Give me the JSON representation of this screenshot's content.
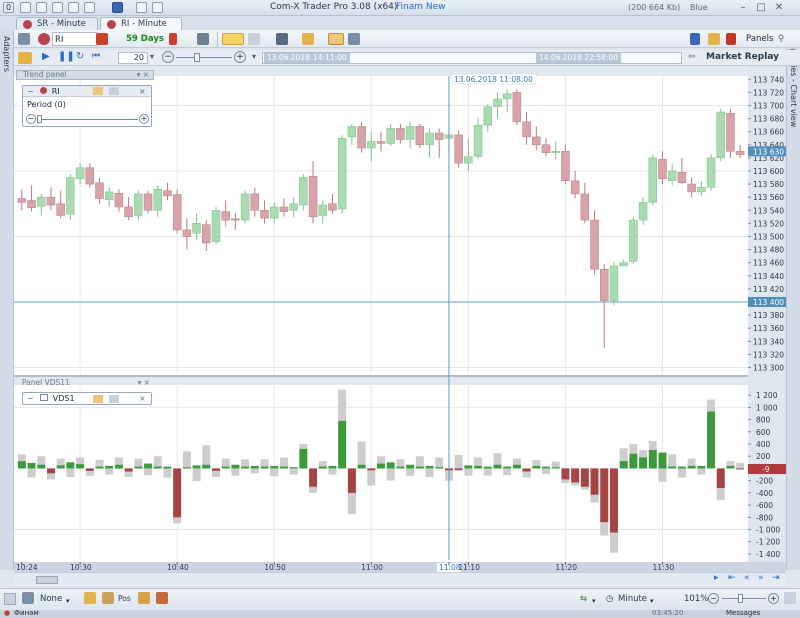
{
  "window": {
    "title": "Com-X Trader Pro 3.08 (x64)",
    "broker": "Finam New",
    "memory": "(200 664 Kb)",
    "theme": "Blue",
    "window_number": "0"
  },
  "tabs": [
    {
      "label": "SR - Minute",
      "active": false
    },
    {
      "label": "RI - Minute",
      "active": true
    }
  ],
  "toolbar": {
    "instrument": "RI",
    "period": "59 Days",
    "panels_label": "Panels"
  },
  "replay": {
    "step": "20",
    "label": "Market Replay",
    "start_date": "13.06.2018",
    "start_time": "14:11:00",
    "end_datetime": "14.06.2018 22:58:00"
  },
  "sidebars": {
    "left_label": "Adapters",
    "right_label": "Properties - Chart view"
  },
  "cursor_label": "13.06.2018 11:08:00",
  "trend_panel": {
    "title": "Trend panel",
    "indicator": "RI",
    "param": "Period (0)"
  },
  "volume_panel": {
    "title": "Panel VDS11",
    "indicator": "VDS1"
  },
  "statusbar": {
    "mode": "None",
    "pos": "Pos",
    "timeframe": "Minute",
    "zoom": "101%",
    "company": "Финам",
    "clock": "03:45:20",
    "messages": "Messages"
  },
  "colors": {
    "up": "#a8dcb0",
    "up_edge": "#7fbf8c",
    "down": "#d8a4aa",
    "down_edge": "#b57c84",
    "vol_pos": "#3c9a3c",
    "vol_neg": "#a64444",
    "vol_gray": "#cdcdcd",
    "axis_bg": "#dfe6ee",
    "price_label_bg": "#4f8fb8",
    "vol_label_bg": "#b23a3a"
  },
  "chart_data": {
    "type": "candlestick",
    "price_axis": [
      "113 740",
      "113 720",
      "113 700",
      "113 680",
      "113 660",
      "113 640",
      "113 620",
      "113 600",
      "113 580",
      "113 560",
      "113 540",
      "113 520",
      "113 500",
      "113 480",
      "113 460",
      "113 440",
      "113 420",
      "113 400",
      "113 380",
      "113 360",
      "113 340",
      "113 320",
      "113 300"
    ],
    "price_ylim": [
      113290,
      113745
    ],
    "current_price": "113 630",
    "cursor_price": "113 400",
    "volume_axis": [
      "1 200",
      "1 000",
      "800",
      "600",
      "400",
      "200",
      "0",
      "-200",
      "-400",
      "-600",
      "-800",
      "-1 000",
      "-1 200",
      "-1 400"
    ],
    "volume_ylim": [
      -1500,
      1350
    ],
    "current_volume": "-9",
    "time_axis": [
      "10:24",
      "10:30",
      "10:40",
      "10:50",
      "11:00",
      "11:08",
      "11:10",
      "11:20",
      "11:30"
    ],
    "time_axis_minutes": [
      624,
      630,
      640,
      650,
      660,
      668,
      670,
      680,
      690
    ],
    "highlighted_time": "11:08",
    "candles": [
      {
        "o": 113558,
        "h": 113572,
        "l": 113540,
        "c": 113552
      },
      {
        "o": 113555,
        "h": 113578,
        "l": 113538,
        "c": 113544
      },
      {
        "o": 113546,
        "h": 113565,
        "l": 113532,
        "c": 113560
      },
      {
        "o": 113560,
        "h": 113575,
        "l": 113540,
        "c": 113548
      },
      {
        "o": 113550,
        "h": 113570,
        "l": 113528,
        "c": 113532
      },
      {
        "o": 113534,
        "h": 113595,
        "l": 113525,
        "c": 113590
      },
      {
        "o": 113588,
        "h": 113612,
        "l": 113580,
        "c": 113605
      },
      {
        "o": 113605,
        "h": 113612,
        "l": 113575,
        "c": 113580
      },
      {
        "o": 113582,
        "h": 113590,
        "l": 113550,
        "c": 113558
      },
      {
        "o": 113556,
        "h": 113575,
        "l": 113545,
        "c": 113568
      },
      {
        "o": 113566,
        "h": 113572,
        "l": 113538,
        "c": 113545
      },
      {
        "o": 113545,
        "h": 113560,
        "l": 113525,
        "c": 113530
      },
      {
        "o": 113532,
        "h": 113570,
        "l": 113525,
        "c": 113565
      },
      {
        "o": 113565,
        "h": 113570,
        "l": 113535,
        "c": 113540
      },
      {
        "o": 113540,
        "h": 113578,
        "l": 113530,
        "c": 113572
      },
      {
        "o": 113570,
        "h": 113582,
        "l": 113555,
        "c": 113562
      },
      {
        "o": 113564,
        "h": 113572,
        "l": 113505,
        "c": 113510
      },
      {
        "o": 113510,
        "h": 113528,
        "l": 113480,
        "c": 113500
      },
      {
        "o": 113505,
        "h": 113535,
        "l": 113495,
        "c": 113520
      },
      {
        "o": 113518,
        "h": 113525,
        "l": 113478,
        "c": 113490
      },
      {
        "o": 113492,
        "h": 113545,
        "l": 113488,
        "c": 113540
      },
      {
        "o": 113538,
        "h": 113555,
        "l": 113515,
        "c": 113525
      },
      {
        "o": 113527,
        "h": 113535,
        "l": 113510,
        "c": 113525
      },
      {
        "o": 113525,
        "h": 113570,
        "l": 113520,
        "c": 113565
      },
      {
        "o": 113565,
        "h": 113575,
        "l": 113530,
        "c": 113540
      },
      {
        "o": 113540,
        "h": 113555,
        "l": 113520,
        "c": 113528
      },
      {
        "o": 113528,
        "h": 113552,
        "l": 113520,
        "c": 113545
      },
      {
        "o": 113545,
        "h": 113558,
        "l": 113530,
        "c": 113538
      },
      {
        "o": 113540,
        "h": 113560,
        "l": 113530,
        "c": 113550
      },
      {
        "o": 113548,
        "h": 113595,
        "l": 113540,
        "c": 113590
      },
      {
        "o": 113592,
        "h": 113615,
        "l": 113520,
        "c": 113530
      },
      {
        "o": 113532,
        "h": 113555,
        "l": 113520,
        "c": 113548
      },
      {
        "o": 113550,
        "h": 113565,
        "l": 113535,
        "c": 113540
      },
      {
        "o": 113542,
        "h": 113655,
        "l": 113535,
        "c": 113650
      },
      {
        "o": 113652,
        "h": 113672,
        "l": 113640,
        "c": 113668
      },
      {
        "o": 113668,
        "h": 113675,
        "l": 113628,
        "c": 113635
      },
      {
        "o": 113635,
        "h": 113660,
        "l": 113615,
        "c": 113645
      },
      {
        "o": 113645,
        "h": 113660,
        "l": 113630,
        "c": 113642
      },
      {
        "o": 113642,
        "h": 113672,
        "l": 113638,
        "c": 113665
      },
      {
        "o": 113665,
        "h": 113672,
        "l": 113642,
        "c": 113648
      },
      {
        "o": 113648,
        "h": 113675,
        "l": 113635,
        "c": 113668
      },
      {
        "o": 113668,
        "h": 113672,
        "l": 113635,
        "c": 113640
      },
      {
        "o": 113640,
        "h": 113665,
        "l": 113620,
        "c": 113658
      },
      {
        "o": 113658,
        "h": 113665,
        "l": 113620,
        "c": 113648
      },
      {
        "o": 113650,
        "h": 113665,
        "l": 113628,
        "c": 113655
      },
      {
        "o": 113655,
        "h": 113662,
        "l": 113605,
        "c": 113612
      },
      {
        "o": 113612,
        "h": 113650,
        "l": 113600,
        "c": 113622
      },
      {
        "o": 113622,
        "h": 113680,
        "l": 113618,
        "c": 113670
      },
      {
        "o": 113670,
        "h": 113702,
        "l": 113660,
        "c": 113698
      },
      {
        "o": 113698,
        "h": 113720,
        "l": 113680,
        "c": 113710
      },
      {
        "o": 113710,
        "h": 113725,
        "l": 113690,
        "c": 113718
      },
      {
        "o": 113720,
        "h": 113725,
        "l": 113670,
        "c": 113675
      },
      {
        "o": 113675,
        "h": 113690,
        "l": 113640,
        "c": 113652
      },
      {
        "o": 113652,
        "h": 113668,
        "l": 113632,
        "c": 113640
      },
      {
        "o": 113640,
        "h": 113650,
        "l": 113622,
        "c": 113628
      },
      {
        "o": 113628,
        "h": 113645,
        "l": 113618,
        "c": 113630
      },
      {
        "o": 113630,
        "h": 113640,
        "l": 113580,
        "c": 113585
      },
      {
        "o": 113585,
        "h": 113600,
        "l": 113558,
        "c": 113565
      },
      {
        "o": 113565,
        "h": 113582,
        "l": 113520,
        "c": 113525
      },
      {
        "o": 113525,
        "h": 113540,
        "l": 113442,
        "c": 113450
      },
      {
        "o": 113450,
        "h": 113458,
        "l": 113330,
        "c": 113402
      },
      {
        "o": 113402,
        "h": 113462,
        "l": 113395,
        "c": 113455
      },
      {
        "o": 113455,
        "h": 113465,
        "l": 113455,
        "c": 113460
      },
      {
        "o": 113462,
        "h": 113530,
        "l": 113458,
        "c": 113525
      },
      {
        "o": 113525,
        "h": 113560,
        "l": 113518,
        "c": 113552
      },
      {
        "o": 113552,
        "h": 113625,
        "l": 113548,
        "c": 113620
      },
      {
        "o": 113618,
        "h": 113630,
        "l": 113580,
        "c": 113588
      },
      {
        "o": 113585,
        "h": 113610,
        "l": 113578,
        "c": 113600
      },
      {
        "o": 113598,
        "h": 113620,
        "l": 113580,
        "c": 113582
      },
      {
        "o": 113580,
        "h": 113590,
        "l": 113560,
        "c": 113568
      },
      {
        "o": 113568,
        "h": 113585,
        "l": 113562,
        "c": 113575
      },
      {
        "o": 113575,
        "h": 113625,
        "l": 113570,
        "c": 113620
      },
      {
        "o": 113620,
        "h": 113695,
        "l": 113615,
        "c": 113690
      },
      {
        "o": 113688,
        "h": 113695,
        "l": 113620,
        "c": 113630
      },
      {
        "o": 113630,
        "h": 113640,
        "l": 113620,
        "c": 113625
      }
    ],
    "volumes": [
      {
        "v": 120,
        "g": 230
      },
      {
        "v": 90,
        "g": -150
      },
      {
        "v": 60,
        "g": 200
      },
      {
        "v": -80,
        "g": -180
      },
      {
        "v": 50,
        "g": 160
      },
      {
        "v": 100,
        "g": -140
      },
      {
        "v": 70,
        "g": 180
      },
      {
        "v": -40,
        "g": -120
      },
      {
        "v": 30,
        "g": 140
      },
      {
        "v": 40,
        "g": -100
      },
      {
        "v": 60,
        "g": 180
      },
      {
        "v": -50,
        "g": -140
      },
      {
        "v": 30,
        "g": 160
      },
      {
        "v": 80,
        "g": -110
      },
      {
        "v": 30,
        "g": 200
      },
      {
        "v": 30,
        "g": -150
      },
      {
        "v": -800,
        "g": -900
      },
      {
        "v": 20,
        "g": 280
      },
      {
        "v": 50,
        "g": -210
      },
      {
        "v": 60,
        "g": 380
      },
      {
        "v": -40,
        "g": -140
      },
      {
        "v": 30,
        "g": 160
      },
      {
        "v": 60,
        "g": -120
      },
      {
        "v": 30,
        "g": 150
      },
      {
        "v": 40,
        "g": -80
      },
      {
        "v": 30,
        "g": 150
      },
      {
        "v": 40,
        "g": -130
      },
      {
        "v": 30,
        "g": 180
      },
      {
        "v": 20,
        "g": -100
      },
      {
        "v": 320,
        "g": 400
      },
      {
        "v": -300,
        "g": -400
      },
      {
        "v": 30,
        "g": 120
      },
      {
        "v": 40,
        "g": -100
      },
      {
        "v": 780,
        "g": 1290
      },
      {
        "v": -400,
        "g": -750
      },
      {
        "v": 60,
        "g": 440
      },
      {
        "v": -30,
        "g": -280
      },
      {
        "v": 80,
        "g": 200
      },
      {
        "v": 100,
        "g": -200
      },
      {
        "v": 30,
        "g": 150
      },
      {
        "v": 60,
        "g": -120
      },
      {
        "v": 30,
        "g": 200
      },
      {
        "v": 40,
        "g": -140
      },
      {
        "v": 20,
        "g": 180
      },
      {
        "v": -30,
        "g": -200
      },
      {
        "v": -30,
        "g": 220
      },
      {
        "v": 50,
        "g": -120
      },
      {
        "v": 40,
        "g": 180
      },
      {
        "v": 30,
        "g": -120
      },
      {
        "v": 60,
        "g": 250
      },
      {
        "v": 30,
        "g": -110
      },
      {
        "v": 60,
        "g": 160
      },
      {
        "v": -50,
        "g": -150
      },
      {
        "v": 40,
        "g": 140
      },
      {
        "v": 30,
        "g": -90
      },
      {
        "v": 20,
        "g": 110
      },
      {
        "v": -180,
        "g": -240
      },
      {
        "v": -230,
        "g": -280
      },
      {
        "v": -300,
        "g": -350
      },
      {
        "v": -430,
        "g": -560
      },
      {
        "v": -880,
        "g": -1100
      },
      {
        "v": -1050,
        "g": -1380
      },
      {
        "v": 120,
        "g": 330
      },
      {
        "v": 240,
        "g": 400
      },
      {
        "v": 180,
        "g": 300
      },
      {
        "v": 300,
        "g": 450
      },
      {
        "v": 260,
        "g": -220
      },
      {
        "v": 30,
        "g": 230
      },
      {
        "v": 30,
        "g": -150
      },
      {
        "v": 40,
        "g": 160
      },
      {
        "v": 40,
        "g": -100
      },
      {
        "v": 930,
        "g": 1130
      },
      {
        "v": -320,
        "g": -520
      },
      {
        "v": 40,
        "g": 120
      },
      {
        "v": -9,
        "g": 90
      }
    ]
  }
}
